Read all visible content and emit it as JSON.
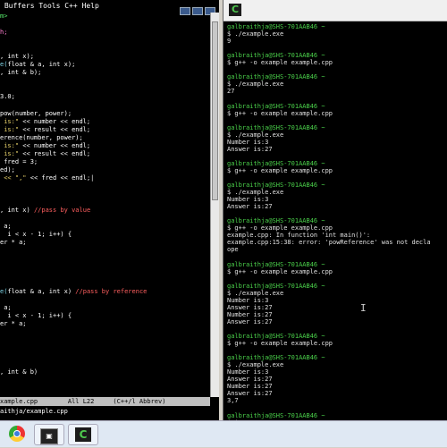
{
  "emacs": {
    "menubar_text": " Buffers Tools C++ Help",
    "code_lines": [
      [
        {
          "t": "m>",
          "c": "c-g"
        }
      ],
      [],
      [
        {
          "t": "h;",
          "c": "c-m"
        }
      ],
      [],
      [],
      [
        {
          "t": ", int x);",
          "c": ""
        }
      ],
      [
        {
          "t": "e(",
          "c": "c-c"
        },
        {
          "t": "float & a, int x);",
          "c": ""
        }
      ],
      [
        {
          "t": ", int & b);",
          "c": ""
        }
      ],
      [],
      [],
      [
        {
          "t": "3.0;",
          "c": ""
        }
      ],
      [],
      [
        {
          "t": "pow(number, power);",
          "c": ""
        }
      ],
      [
        {
          "t": " is:\"",
          "c": "c-y"
        },
        {
          "t": " << number << endl;",
          "c": ""
        }
      ],
      [
        {
          "t": " is:\"",
          "c": "c-y"
        },
        {
          "t": " << result << endl;",
          "c": ""
        }
      ],
      [
        {
          "t": "erence(number, power);",
          "c": ""
        }
      ],
      [
        {
          "t": " is:\"",
          "c": "c-y"
        },
        {
          "t": " << number << endl;",
          "c": ""
        }
      ],
      [
        {
          "t": " is:\"",
          "c": "c-y"
        },
        {
          "t": " << result << endl;",
          "c": ""
        }
      ],
      [
        {
          "t": " fred = 3;",
          "c": ""
        }
      ],
      [
        {
          "t": "ed);",
          "c": ""
        }
      ],
      [
        {
          "t": " << \",\"",
          "c": "c-y"
        },
        {
          "t": " << fred << endl;|",
          "c": ""
        }
      ],
      [],
      [],
      [],
      [
        {
          "t": ", int x) ",
          "c": ""
        },
        {
          "t": "//pass by value",
          "c": "c-r"
        }
      ],
      [],
      [
        {
          "t": " a;",
          "c": ""
        }
      ],
      [
        {
          "t": "  i < x - 1; i++) {",
          "c": ""
        }
      ],
      [
        {
          "t": "er * a;",
          "c": ""
        }
      ],
      [],
      [],
      [],
      [],
      [],
      [
        {
          "t": "e(",
          "c": "c-c"
        },
        {
          "t": "float & a, int x) ",
          "c": ""
        },
        {
          "t": "//pass by reference",
          "c": "c-r"
        }
      ],
      [],
      [
        {
          "t": " a;",
          "c": ""
        }
      ],
      [
        {
          "t": "  i < x - 1; i++) {",
          "c": ""
        }
      ],
      [
        {
          "t": "er * a;",
          "c": ""
        }
      ],
      [],
      [],
      [],
      [],
      [],
      [
        {
          "t": ", int & b)",
          "c": ""
        }
      ],
      [],
      [],
      []
    ],
    "modeline": "xample.cpp        All L22     (C++/l Abbrev)",
    "minibuffer": "aithja/example.cpp"
  },
  "cygwin": {
    "title_icon": "C",
    "lines": [
      {
        "p": "galbraithja@SHS-701AAB46 ~"
      },
      {
        "s": "$ ./example.exe"
      },
      {
        "s": "9"
      },
      {
        "s": ""
      },
      {
        "p": "galbraithja@SHS-701AAB46 ~"
      },
      {
        "s": "$ g++ -o example example.cpp"
      },
      {
        "s": ""
      },
      {
        "p": "galbraithja@SHS-701AAB46 ~"
      },
      {
        "s": "$ ./example.exe"
      },
      {
        "s": "27"
      },
      {
        "s": ""
      },
      {
        "p": "galbraithja@SHS-701AAB46 ~"
      },
      {
        "s": "$ g++ -o example example.cpp"
      },
      {
        "s": ""
      },
      {
        "p": "galbraithja@SHS-701AAB46 ~"
      },
      {
        "s": "$ ./example.exe"
      },
      {
        "s": "Number is:3"
      },
      {
        "s": "Answer is:27"
      },
      {
        "s": ""
      },
      {
        "p": "galbraithja@SHS-701AAB46 ~"
      },
      {
        "s": "$ g++ -o example example.cpp"
      },
      {
        "s": ""
      },
      {
        "p": "galbraithja@SHS-701AAB46 ~"
      },
      {
        "s": "$ ./example.exe"
      },
      {
        "s": "Number is:3"
      },
      {
        "s": "Answer is:27"
      },
      {
        "s": ""
      },
      {
        "p": "galbraithja@SHS-701AAB46 ~"
      },
      {
        "s": "$ g++ -o example example.cpp"
      },
      {
        "s": "example.cpp: In function 'int main()':"
      },
      {
        "s": "example.cpp:15:38: error: 'powReference' was not decla"
      },
      {
        "s": "ope"
      },
      {
        "s": ""
      },
      {
        "p": "galbraithja@SHS-701AAB46 ~"
      },
      {
        "s": "$ g++ -o example example.cpp"
      },
      {
        "s": ""
      },
      {
        "p": "galbraithja@SHS-701AAB46 ~"
      },
      {
        "s": "$ ./example.exe"
      },
      {
        "s": "Number is:3"
      },
      {
        "s": "Answer is:27"
      },
      {
        "s": "Number is:27"
      },
      {
        "s": "Answer is:27"
      },
      {
        "s": ""
      },
      {
        "p": "galbraithja@SHS-701AAB46 ~"
      },
      {
        "s": "$ g++ -o example example.cpp"
      },
      {
        "s": ""
      },
      {
        "p": "galbraithja@SHS-701AAB46 ~"
      },
      {
        "s": "$ ./example.exe"
      },
      {
        "s": "Number is:3"
      },
      {
        "s": "Answer is:27"
      },
      {
        "s": "Number is:27"
      },
      {
        "s": "Answer is:27"
      },
      {
        "s": "3,7"
      },
      {
        "s": ""
      },
      {
        "p": "galbraithja@SHS-701AAB46 ~"
      },
      {
        "s": "$ |"
      }
    ]
  },
  "taskbar": {
    "items": [
      {
        "name": "chrome",
        "icon": "chrome-icon"
      },
      {
        "name": "emacs",
        "icon": "emacs-icon",
        "glyph": "▣"
      },
      {
        "name": "cygwin",
        "icon": "cygwin-icon",
        "glyph": "C"
      }
    ]
  }
}
